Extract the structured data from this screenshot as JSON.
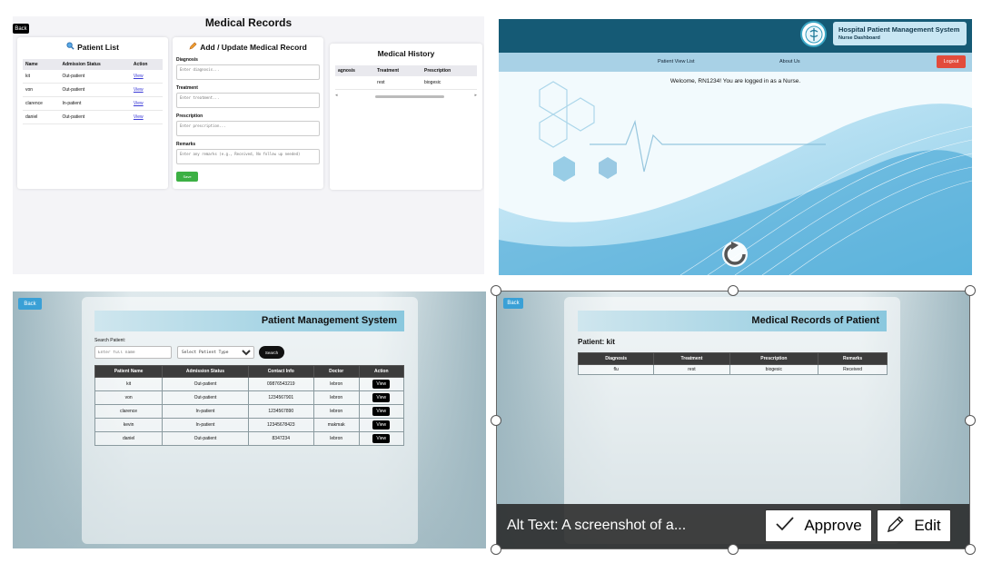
{
  "records": {
    "back": "Back",
    "title": "Medical Records",
    "patient_list": {
      "title": "Patient List",
      "headers": [
        "Name",
        "Admission Status",
        "Action"
      ],
      "rows": [
        {
          "name": "kit",
          "status": "Out-patient",
          "action": "View"
        },
        {
          "name": "von",
          "status": "Out-patient",
          "action": "View"
        },
        {
          "name": "clarence",
          "status": "In-patient",
          "action": "View"
        },
        {
          "name": "daniel",
          "status": "Out-patient",
          "action": "View"
        }
      ]
    },
    "form": {
      "title": "Add / Update Medical Record",
      "diagnosis_label": "Diagnosis",
      "diagnosis_ph": "Enter diagnosis...",
      "treatment_label": "Treatment",
      "treatment_ph": "Enter treatment...",
      "prescription_label": "Prescription",
      "prescription_ph": "Enter prescription...",
      "remarks_label": "Remarks",
      "remarks_ph": "Enter any remarks (e.g., Received, No follow up needed)",
      "save": "Save"
    },
    "history": {
      "title": "Medical History",
      "headers": [
        "agnosis",
        "Treatment",
        "Prescription"
      ],
      "rows": [
        {
          "diagnosis": "",
          "treatment": "rest",
          "prescription": "biogesic"
        }
      ]
    }
  },
  "dashboard": {
    "system_title": "Hospital Patient Management System",
    "subtitle": "Nurse Dashboard",
    "nav": [
      "Patient View List",
      "About Us"
    ],
    "logout": "Logout",
    "welcome": "Welcome, RN1234! You are logged in as a Nurse."
  },
  "management": {
    "back": "Back",
    "title": "Patient Management System",
    "search_label": "Search Patient:",
    "search_ph": "Enter full name",
    "select_value": "Select Patient Type",
    "search_btn": "Search",
    "headers": [
      "Patient Name",
      "Admission Status",
      "Contact Info",
      "Doctor",
      "Action"
    ],
    "rows": [
      {
        "name": "kit",
        "status": "Out-patient",
        "contact": "09876543219",
        "doctor": "lebron",
        "action": "View"
      },
      {
        "name": "von",
        "status": "Out-patient",
        "contact": "1234567901",
        "doctor": "lebron",
        "action": "View"
      },
      {
        "name": "clarence",
        "status": "In-patient",
        "contact": "1234567890",
        "doctor": "lebron",
        "action": "View"
      },
      {
        "name": "kevin",
        "status": "In-patient",
        "contact": "12345678423",
        "doctor": "makmak",
        "action": "View"
      },
      {
        "name": "daniel",
        "status": "Out-patient",
        "contact": "8347234",
        "doctor": "lebron",
        "action": "View"
      }
    ]
  },
  "patient_records": {
    "back": "Back",
    "title": "Medical Records of Patient",
    "patient_label": "Patient: kit",
    "headers": [
      "Diagnosis",
      "Treatment",
      "Prescription",
      "Remarks"
    ],
    "rows": [
      {
        "diagnosis": "flu",
        "treatment": "rest",
        "prescription": "biogesic",
        "remarks": "Received"
      }
    ]
  },
  "alt_text": {
    "text": "Alt Text: A screenshot of a...",
    "approve": "Approve",
    "edit": "Edit"
  },
  "colors": {
    "header": "#155a75",
    "logout": "#e24b3b",
    "save": "#3cb044",
    "back": "#3aa0d6"
  }
}
